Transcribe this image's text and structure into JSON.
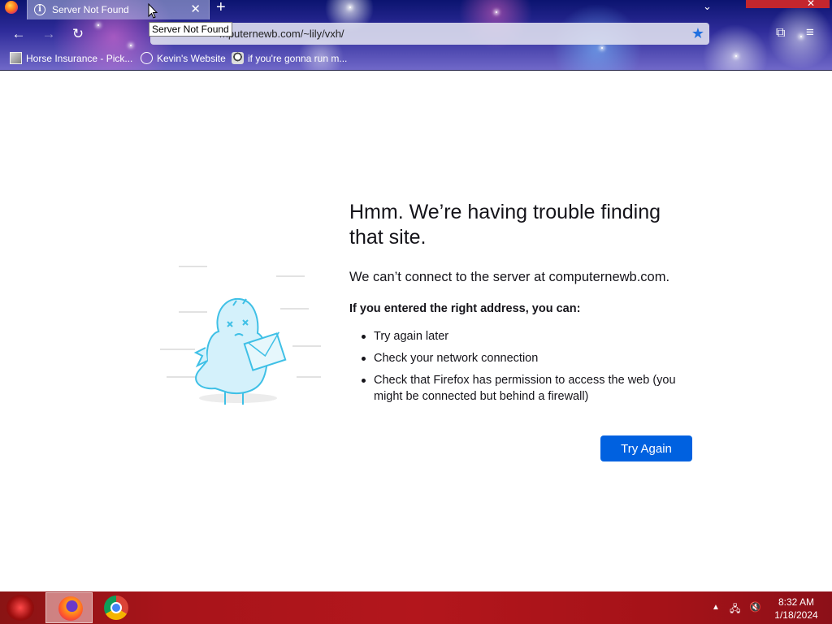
{
  "browser": {
    "tab": {
      "title": "Server Not Found",
      "tooltip": "Server Not Found"
    },
    "url_bar": {
      "value": "computernewb.com/~lily/vxh/",
      "visible_value": "mputernewb.com/~lily/vxh/"
    },
    "bookmarks": [
      {
        "label": "Horse Insurance - Pick..."
      },
      {
        "label": "Kevin's Website"
      },
      {
        "label": "if you're gonna run m..."
      }
    ]
  },
  "error_page": {
    "title": "Hmm. We’re having trouble finding that site.",
    "description": "We can’t connect to the server at computernewb.com.",
    "subhead": "If you entered the right address, you can:",
    "suggestions": [
      "Try again later",
      "Check your network connection",
      "Check that Firefox has permission to access the web (you might be connected but behind a firewall)"
    ],
    "try_again_label": "Try Again"
  },
  "taskbar": {
    "time": "8:32 AM",
    "date": "1/18/2024"
  },
  "colors": {
    "primary_button": "#0061e0",
    "taskbar": "#b3161c",
    "chrome_theme": "#2f2c9a"
  },
  "icons": [
    "firefox-icon",
    "info-icon",
    "close-icon",
    "plus-icon",
    "back-arrow-icon",
    "forward-arrow-icon",
    "reload-icon",
    "bookmark-star-icon",
    "extensions-icon",
    "hamburger-menu-icon",
    "globe-icon",
    "firefox-taskbar-icon",
    "chrome-taskbar-icon",
    "network-icon",
    "volume-muted-icon"
  ]
}
